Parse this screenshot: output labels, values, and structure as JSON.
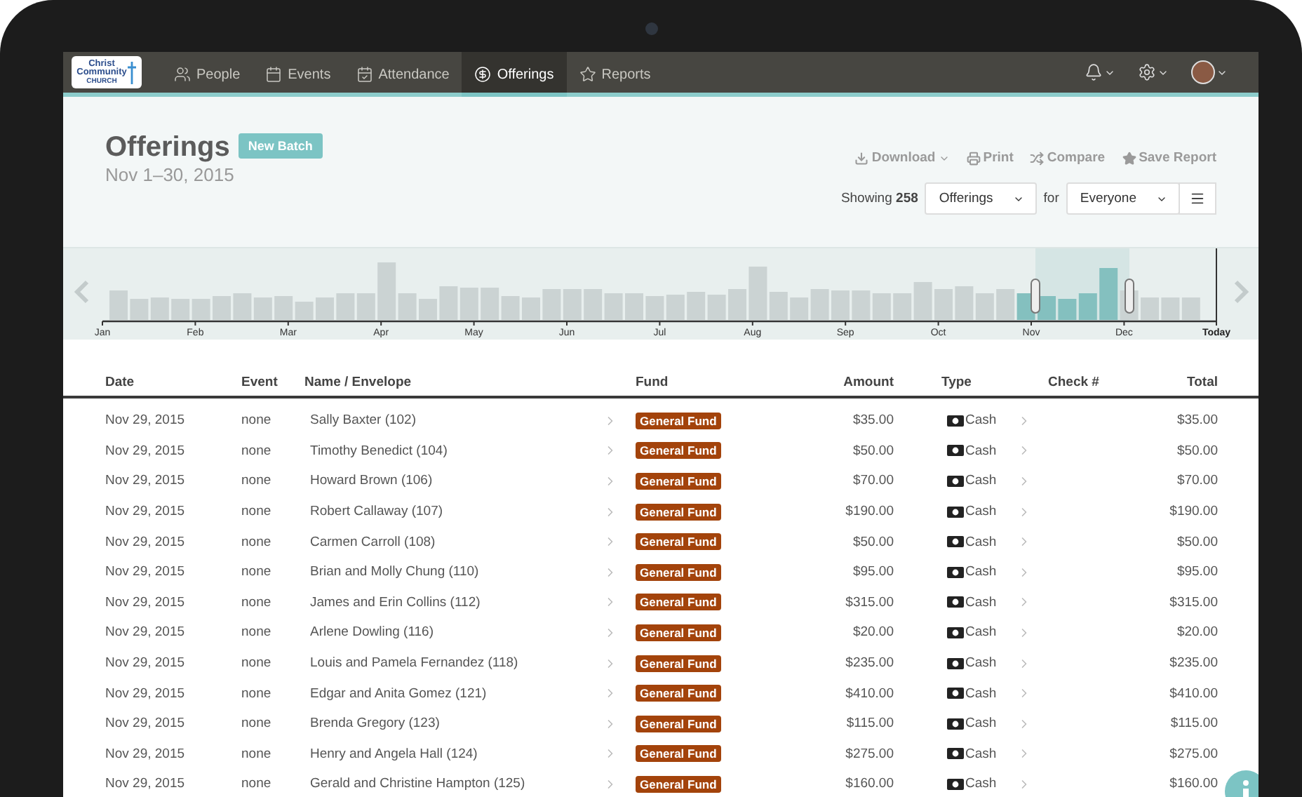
{
  "logo": {
    "lines": [
      "Christ",
      "Community",
      "CHURCH"
    ]
  },
  "nav": {
    "tabs": [
      {
        "label": "People",
        "selected": false
      },
      {
        "label": "Events",
        "selected": false
      },
      {
        "label": "Attendance",
        "selected": false
      },
      {
        "label": "Offerings",
        "selected": true
      },
      {
        "label": "Reports",
        "selected": false
      }
    ]
  },
  "page": {
    "title": "Offerings",
    "new_button": "New Batch",
    "subtitle": "Nov 1–30, 2015"
  },
  "actions": [
    {
      "label": "Download",
      "dropdown": true
    },
    {
      "label": "Print",
      "dropdown": false
    },
    {
      "label": "Compare",
      "dropdown": false
    },
    {
      "label": "Save Report",
      "dropdown": false
    }
  ],
  "filter": {
    "showing": "Showing **258**",
    "type_select": "Offerings",
    "for_label": "for",
    "people_select": "Everyone"
  },
  "timeline": {
    "axis_labels": [
      {
        "label": "Jan",
        "kind": "month"
      },
      {
        "label": "Feb",
        "kind": "month"
      },
      {
        "label": "Mar",
        "kind": "month"
      },
      {
        "label": "Apr",
        "kind": "month"
      },
      {
        "label": "May",
        "kind": "month"
      },
      {
        "label": "Jun",
        "kind": "month"
      },
      {
        "label": "Jul",
        "kind": "month"
      },
      {
        "label": "Aug",
        "kind": "month"
      },
      {
        "label": "Sep",
        "kind": "month"
      },
      {
        "label": "Oct",
        "kind": "month"
      },
      {
        "label": "Nov",
        "kind": "month"
      },
      {
        "label": "Dec",
        "kind": "month"
      },
      {
        "label": "Today",
        "kind": "today"
      }
    ]
  },
  "table": {
    "columns": [
      "Date",
      "Event",
      "Name / Envelope",
      "Fund",
      "Amount",
      "Type",
      "Check #",
      "Total"
    ],
    "rows": [
      {
        "date": "Nov 29, 2015",
        "event": "none",
        "name": "Sally Baxter (102)",
        "fund": "General Fund",
        "amount": "$35.00",
        "type": "Cash",
        "total": "$35.00"
      },
      {
        "date": "Nov 29, 2015",
        "event": "none",
        "name": "Timothy Benedict (104)",
        "fund": "General Fund",
        "amount": "$50.00",
        "type": "Cash",
        "total": "$50.00"
      },
      {
        "date": "Nov 29, 2015",
        "event": "none",
        "name": "Howard Brown (106)",
        "fund": "General Fund",
        "amount": "$70.00",
        "type": "Cash",
        "total": "$70.00"
      },
      {
        "date": "Nov 29, 2015",
        "event": "none",
        "name": "Robert Callaway (107)",
        "fund": "General Fund",
        "amount": "$190.00",
        "type": "Cash",
        "total": "$190.00"
      },
      {
        "date": "Nov 29, 2015",
        "event": "none",
        "name": "Carmen Carroll (108)",
        "fund": "General Fund",
        "amount": "$50.00",
        "type": "Cash",
        "total": "$50.00"
      },
      {
        "date": "Nov 29, 2015",
        "event": "none",
        "name": "Brian and Molly Chung (110)",
        "fund": "General Fund",
        "amount": "$95.00",
        "type": "Cash",
        "total": "$95.00"
      },
      {
        "date": "Nov 29, 2015",
        "event": "none",
        "name": "James and Erin Collins (112)",
        "fund": "General Fund",
        "amount": "$315.00",
        "type": "Cash",
        "total": "$315.00"
      },
      {
        "date": "Nov 29, 2015",
        "event": "none",
        "name": "Arlene Dowling (116)",
        "fund": "General Fund",
        "amount": "$20.00",
        "type": "Cash",
        "total": "$20.00"
      },
      {
        "date": "Nov 29, 2015",
        "event": "none",
        "name": "Louis and Pamela Fernandez (118)",
        "fund": "General Fund",
        "amount": "$235.00",
        "type": "Cash",
        "total": "$235.00"
      },
      {
        "date": "Nov 29, 2015",
        "event": "none",
        "name": "Edgar and Anita Gomez (121)",
        "fund": "General Fund",
        "amount": "$410.00",
        "type": "Cash",
        "total": "$410.00"
      },
      {
        "date": "Nov 29, 2015",
        "event": "none",
        "name": "Brenda Gregory (123)",
        "fund": "General Fund",
        "amount": "$115.00",
        "type": "Cash",
        "total": "$115.00"
      },
      {
        "date": "Nov 29, 2015",
        "event": "none",
        "name": "Henry and Angela Hall (124)",
        "fund": "General Fund",
        "amount": "$275.00",
        "type": "Cash",
        "total": "$275.00"
      },
      {
        "date": "Nov 29, 2015",
        "event": "none",
        "name": "Gerald and Christine Hampton (125)",
        "fund": "General Fund",
        "amount": "$160.00",
        "type": "Cash",
        "total": "$160.00"
      }
    ]
  }
}
